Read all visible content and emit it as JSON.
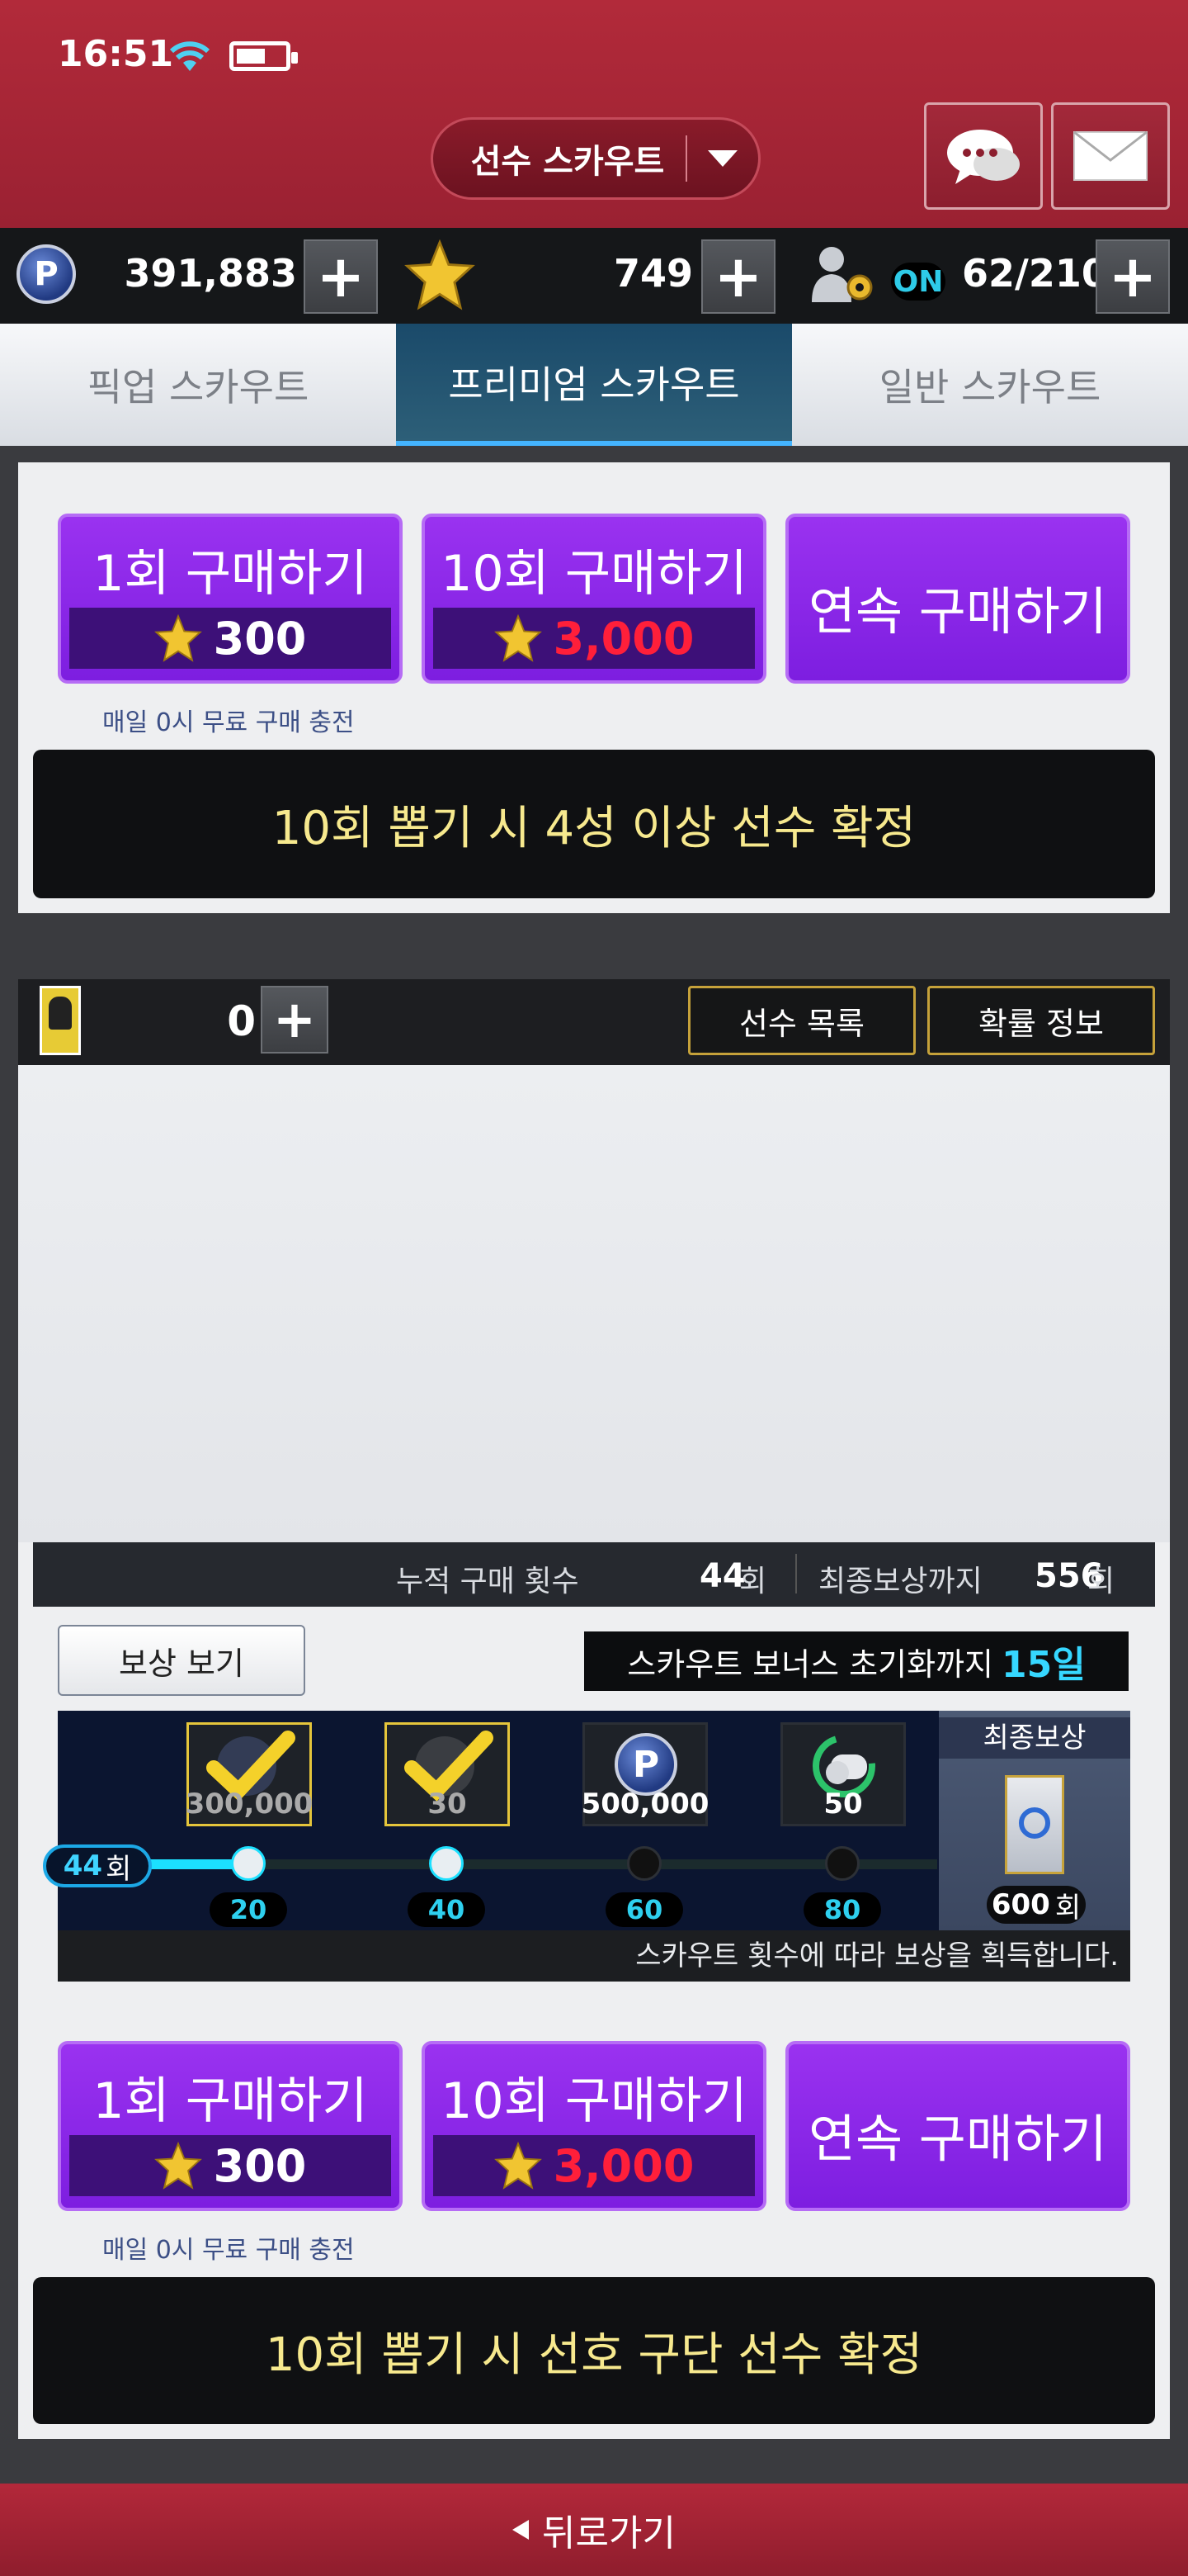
{
  "status": {
    "time": "16:51"
  },
  "header": {
    "title": "선수 스카우트"
  },
  "currency": {
    "points": "391,883",
    "stars": "749",
    "players": "62/210",
    "auto_toggle": "ON"
  },
  "tabs": [
    {
      "label": "픽업 스카우트"
    },
    {
      "label": "프리미엄 스카우트"
    },
    {
      "label": "일반 스카우트"
    }
  ],
  "top_panel": {
    "buy_once": {
      "label": "1회 구매하기",
      "price": "300"
    },
    "buy_ten": {
      "label": "10회 구매하기",
      "price": "3,000"
    },
    "buy_continuous": {
      "label": "연속 구매하기"
    },
    "free_note": "매일 0시 무료 구매 충전",
    "banner": "10회 뽑기 시 4성 이상 선수 확정"
  },
  "ticket_bar": {
    "count": "0",
    "player_list": "선수 목록",
    "probability": "확률 정보"
  },
  "purchase_count": {
    "label": "누적 구매 횟수",
    "value": "44",
    "unit": "회",
    "final_label": "최종보상까지",
    "final_value": "556",
    "final_unit": "회"
  },
  "rewards": {
    "view_button": "보상 보기",
    "bonus_reset_label": "스카우트 보너스 초기화까지",
    "bonus_reset_days": "15일",
    "current_count": "44",
    "current_unit": "회",
    "progress_fraction": 0.078,
    "items": [
      {
        "amount": "300,000",
        "milestone": "20",
        "claimed": true
      },
      {
        "amount": "30",
        "milestone": "40",
        "claimed": true
      },
      {
        "amount": "500,000",
        "milestone": "60",
        "claimed": false
      },
      {
        "amount": "50",
        "milestone": "80",
        "claimed": false
      }
    ],
    "final_title": "최종보상",
    "final_count": "600",
    "final_unit": "회",
    "note": "스카우트 횟수에 따라 보상을 획득합니다."
  },
  "bottom_panel": {
    "buy_once": {
      "label": "1회 구매하기",
      "price": "300"
    },
    "buy_ten": {
      "label": "10회 구매하기",
      "price": "3,000"
    },
    "buy_continuous": {
      "label": "연속 구매하기"
    },
    "free_note": "매일 0시 무료 구매 충전",
    "banner": "10회 뽑기 시 선호 구단 선수 확정"
  },
  "footer": {
    "back_label": "뒤로가기"
  },
  "colors": {
    "header_red": "#a3253a",
    "purple": "#8a28e8",
    "accent_cyan": "#1ce0ff",
    "price_red": "#ff1f3a"
  }
}
